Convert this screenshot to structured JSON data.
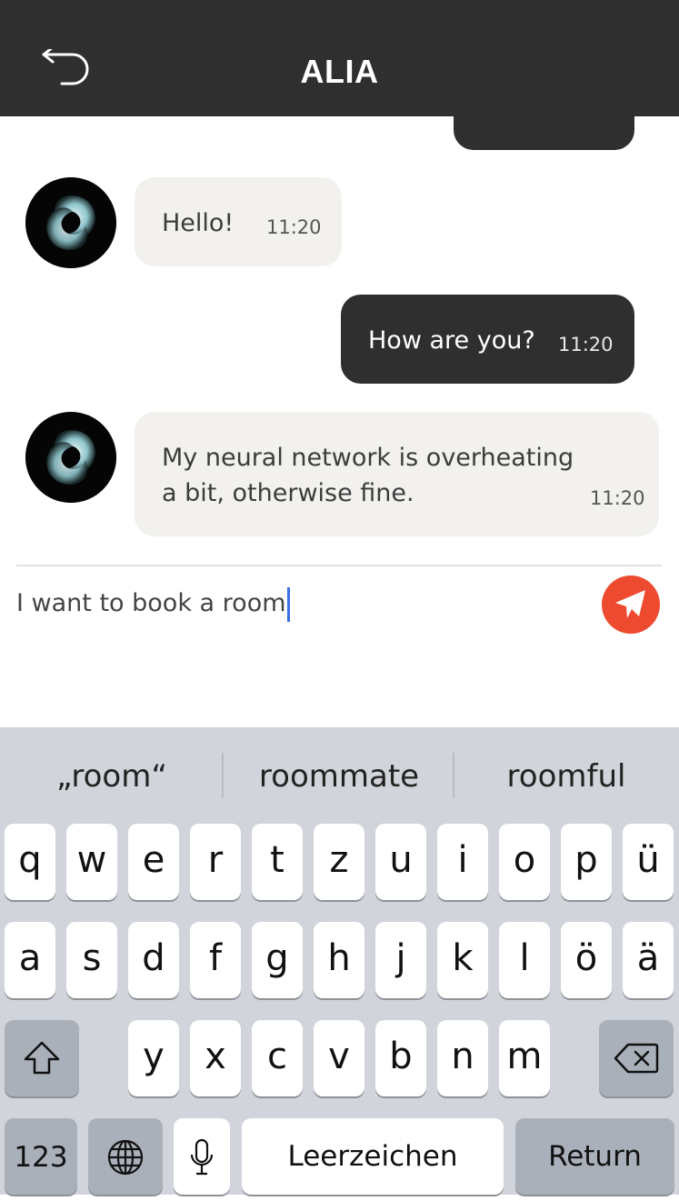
{
  "header": {
    "title": "ALIA"
  },
  "messages": [
    {
      "side": "in",
      "text_lines": [
        "Hello!"
      ],
      "time": "11:20"
    },
    {
      "side": "out",
      "text_lines": [
        "How are you?"
      ],
      "time": "11:20"
    },
    {
      "side": "in",
      "text_lines": [
        "My neural network is overheating",
        "a bit, otherwise fine."
      ],
      "time": "11:20"
    }
  ],
  "input": {
    "value": "I want to book a room"
  },
  "suggestions": [
    "„room“",
    "roommate",
    "roomful"
  ],
  "keyboard": {
    "row1": [
      "q",
      "w",
      "e",
      "r",
      "t",
      "z",
      "u",
      "i",
      "o",
      "p",
      "ü"
    ],
    "row2": [
      "a",
      "s",
      "d",
      "f",
      "g",
      "h",
      "j",
      "k",
      "l",
      "ö",
      "ä"
    ],
    "row3": [
      "y",
      "x",
      "c",
      "v",
      "b",
      "n",
      "m"
    ],
    "numbers_label": "123",
    "space_label": "Leerzeichen",
    "return_label": "Return"
  },
  "colors": {
    "header": "#2f2f2f",
    "send_button": "#ee4a30",
    "caret": "#3a6ee8"
  }
}
